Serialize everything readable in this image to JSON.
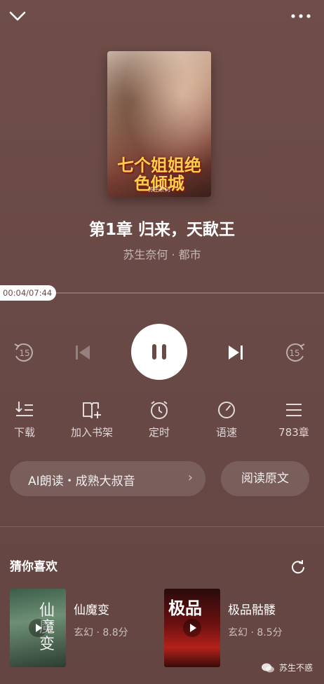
{
  "cover": {
    "title": "七个姐姐绝色倾城",
    "author": "苏生奈何"
  },
  "chapter": {
    "title": "第1章 归来，天歃王",
    "meta": "苏生奈何 · 都市"
  },
  "progress": {
    "current": "00:04",
    "total": "07:44",
    "label": "00:04/07:44",
    "fraction": 0.009
  },
  "transport": {
    "rewind_seconds": "15",
    "forward_seconds": "15"
  },
  "functions": [
    {
      "label": "下载",
      "icon": "download-icon"
    },
    {
      "label": "加入书架",
      "icon": "bookshelf-add-icon"
    },
    {
      "label": "定时",
      "icon": "timer-icon"
    },
    {
      "label": "语速",
      "icon": "speed-icon"
    },
    {
      "label": "783章",
      "icon": "chapter-list-icon"
    }
  ],
  "ai_voice": {
    "label": "AI朗读・成熟大叔音",
    "chevron": "›"
  },
  "read_original": "阅读原文",
  "recommend": {
    "title": "猜你喜欢",
    "books": [
      {
        "name": "仙魔变",
        "info": "玄幻 · 8.8分",
        "cover_text": "仙魔变"
      },
      {
        "name": "极品骷髅",
        "info": "玄幻 · 8.5分",
        "cover_text": "极品"
      }
    ]
  },
  "watermark": "苏生不惑",
  "colors": {
    "background": "#6b4a45",
    "accent": "#ffffff"
  }
}
